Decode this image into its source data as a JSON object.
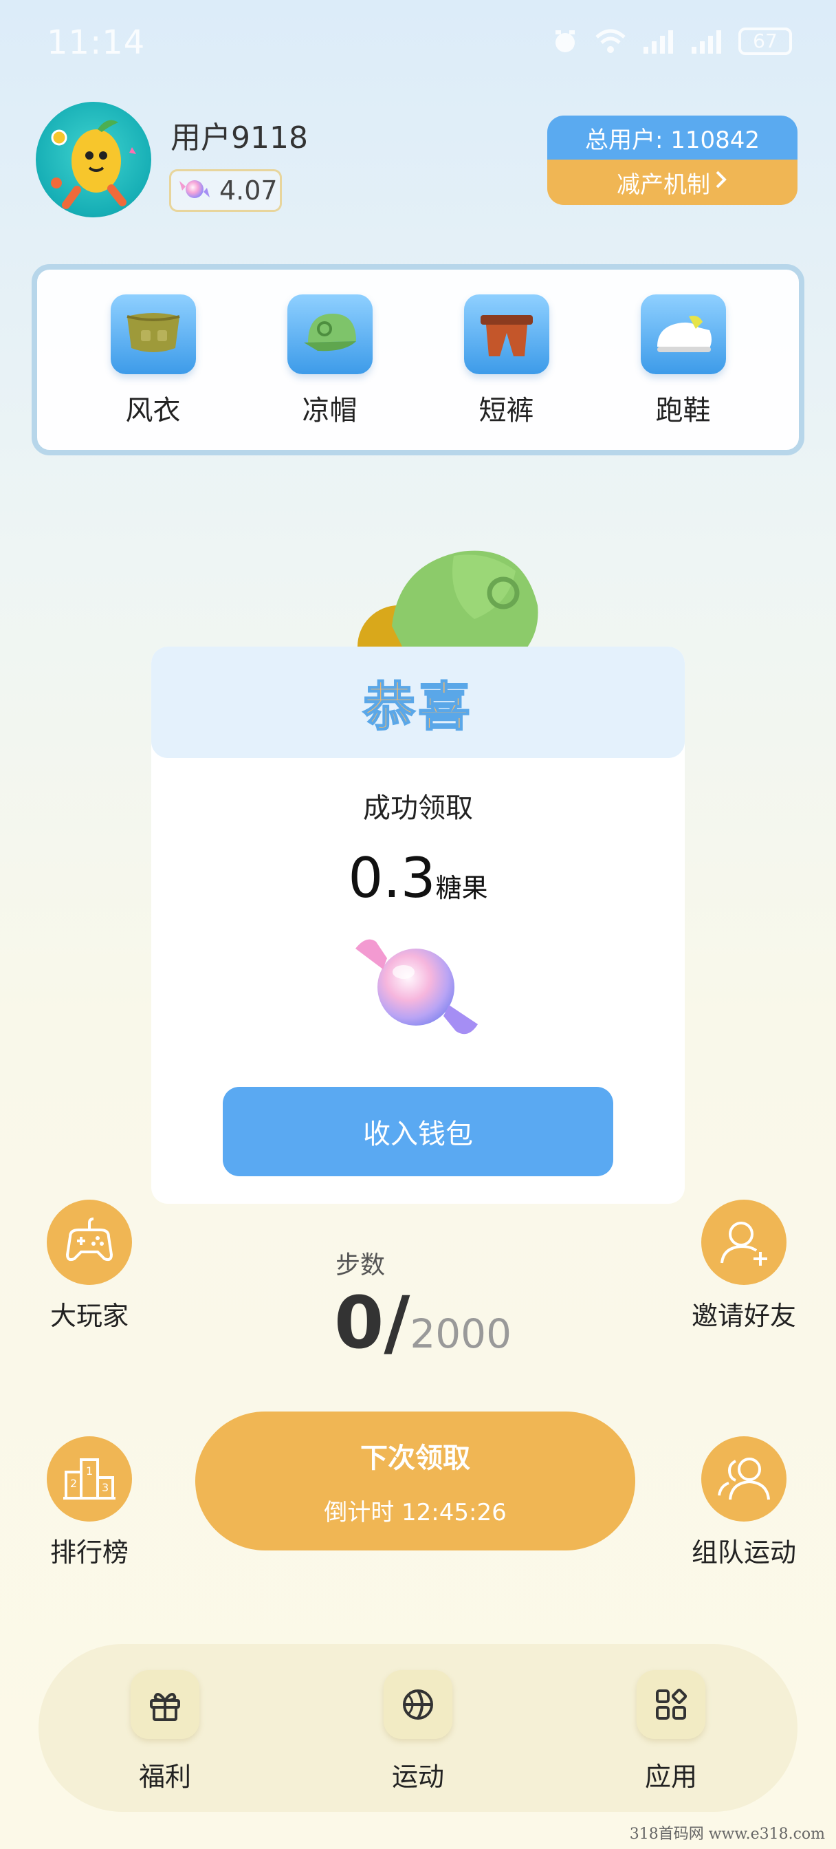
{
  "status_bar": {
    "time": "11:14",
    "battery": "67"
  },
  "profile": {
    "username": "用户9118",
    "candy_balance": "4.07"
  },
  "stats": {
    "total_users": "总用户: 110842",
    "mechanism": "减产机制"
  },
  "items": [
    {
      "label": "风衣",
      "icon": "trench-coat-icon"
    },
    {
      "label": "凉帽",
      "icon": "cap-icon"
    },
    {
      "label": "短裤",
      "icon": "shorts-icon"
    },
    {
      "label": "跑鞋",
      "icon": "running-shoe-icon"
    }
  ],
  "dialog": {
    "title": "恭喜",
    "subtitle": "成功领取",
    "amount": "0.3",
    "unit": "糖果",
    "button": "收入钱包"
  },
  "side_buttons": {
    "big_player": "大玩家",
    "invite": "邀请好友",
    "leaderboard": "排行榜",
    "team": "组队运动"
  },
  "steps": {
    "label": "步数",
    "current": "0/",
    "goal": "2000"
  },
  "claim": {
    "title": "下次领取",
    "countdown": "倒计时 12:45:26"
  },
  "bottom_nav": [
    {
      "label": "福利",
      "icon": "gift-icon"
    },
    {
      "label": "运动",
      "icon": "basketball-icon"
    },
    {
      "label": "应用",
      "icon": "apps-icon"
    }
  ],
  "watermark": "318首码网  www.e318.com",
  "colors": {
    "accent_orange": "#f0b654",
    "accent_blue": "#5aa9f2"
  }
}
